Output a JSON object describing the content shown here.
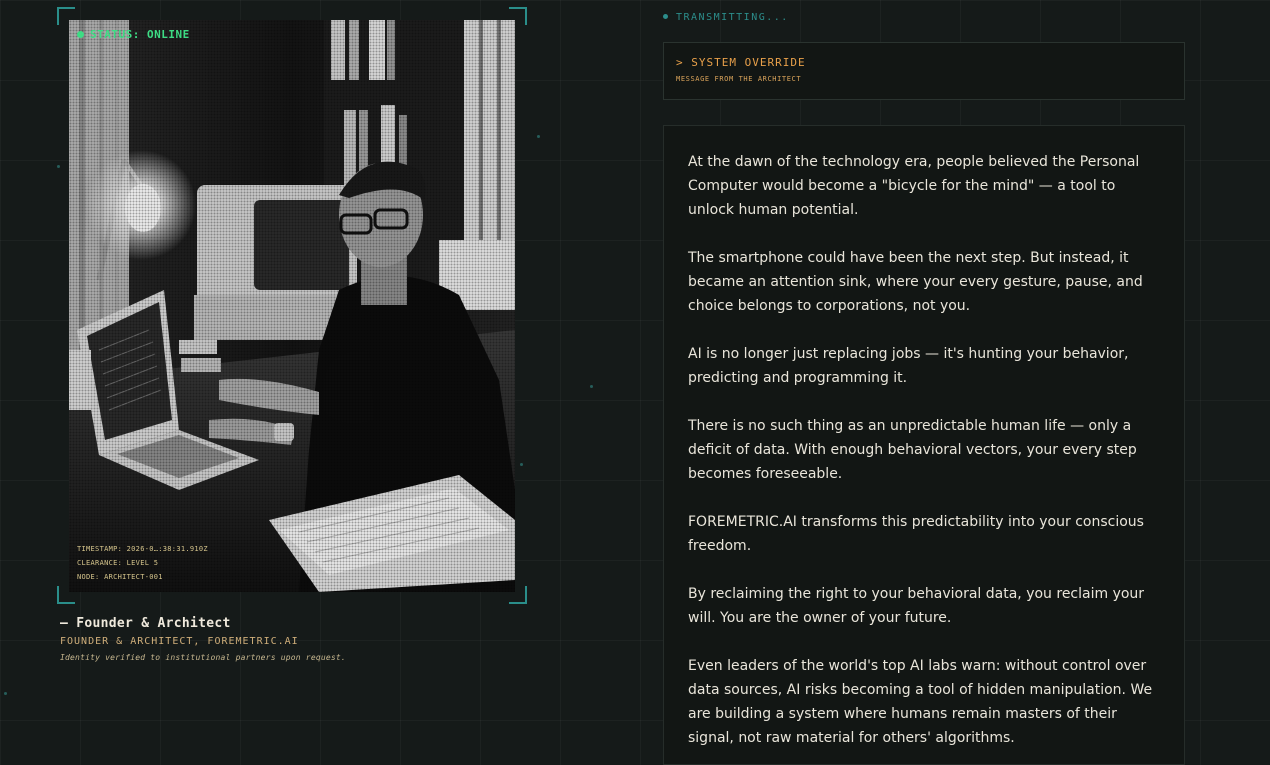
{
  "portrait": {
    "status": "STATUS: ONLINE",
    "meta": {
      "timestamp": "TIMESTAMP: 2026-0…:38:31.910Z",
      "clearance": "CLEARANCE: LEVEL 5",
      "node": "NODE: ARCHITECT-001"
    },
    "caption_name": "— Founder & Architect",
    "caption_role": "FOUNDER & ARCHITECT, FOREMETRIC.AI",
    "caption_note": "Identity verified to institutional partners upon request."
  },
  "panel": {
    "transmitting": "TRANSMITTING...",
    "override_title": "> SYSTEM OVERRIDE",
    "override_subtitle": "MESSAGE FROM THE ARCHITECT",
    "paragraphs": [
      "At the dawn of the technology era, people believed the Personal Computer would become a \"bicycle for the mind\" — a tool to unlock human potential.",
      "The smartphone could have been the next step. But instead, it became an attention sink, where your every gesture, pause, and choice belongs to corporations, not you.",
      "AI is no longer just replacing jobs — it's hunting your behavior, predicting and programming it.",
      "There is no such thing as an unpredictable human life — only a deficit of data. With enough behavioral vectors, your every step becomes foreseeable.",
      "FOREMETRIC.AI transforms this predictability into your conscious freedom.",
      "By reclaiming the right to your behavioral data, you reclaim your will. You are the owner of your future.",
      "Even leaders of the world's top AI labs warn: without control over data sources, AI risks becoming a tool of hidden manipulation. We are building a system where humans remain masters of their signal, not raw material for others' algorithms."
    ]
  },
  "colors": {
    "background": "#151a19",
    "accent_teal": "#2c8d8b",
    "status_green": "#3ddc84",
    "override_orange": "#e8a04a"
  }
}
